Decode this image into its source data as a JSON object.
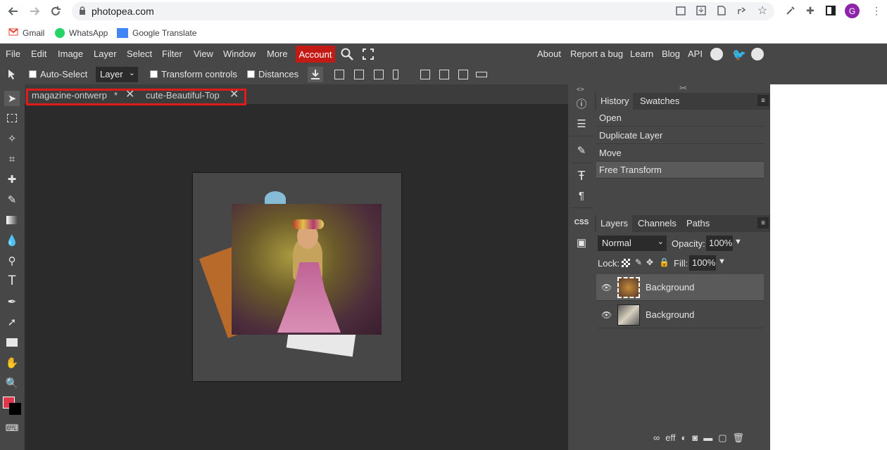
{
  "browser": {
    "url": "photopea.com",
    "avatar_letter": "G",
    "bookmarks": [
      {
        "label": "Gmail",
        "icon": "gmail-icon"
      },
      {
        "label": "WhatsApp",
        "icon": "whatsapp-icon"
      },
      {
        "label": "Google Translate",
        "icon": "translate-icon"
      }
    ]
  },
  "menubar": {
    "items": [
      "File",
      "Edit",
      "Image",
      "Layer",
      "Select",
      "Filter",
      "View",
      "Window",
      "More"
    ],
    "account_label": "Account",
    "right_links": [
      "About",
      "Report a bug",
      "Learn",
      "Blog",
      "API"
    ]
  },
  "options": {
    "auto_select": "Auto-Select",
    "layer_select": "Layer",
    "transform_controls": "Transform controls",
    "distances": "Distances"
  },
  "tabs": [
    {
      "label": "magazine-ontwerp",
      "modified": "*"
    },
    {
      "label": "cute-Beautiful-Top"
    }
  ],
  "history_panel": {
    "tabs": [
      "History",
      "Swatches"
    ],
    "rows": [
      "Open",
      "Duplicate Layer",
      "Move",
      "Free Transform"
    ],
    "selected": "Free Transform"
  },
  "layers_panel": {
    "tabs": [
      "Layers",
      "Channels",
      "Paths"
    ],
    "blend_mode": "Normal",
    "opacity_label": "Opacity:",
    "opacity_value": "100%",
    "lock_label": "Lock:",
    "fill_label": "Fill:",
    "fill_value": "100%",
    "layers": [
      {
        "name": "Background",
        "selected": true
      },
      {
        "name": "Background",
        "selected": false
      }
    ]
  },
  "colors": {
    "accent_red": "#c41a16",
    "highlight_border": "#e01b1b",
    "foreground_color": "#e0364b",
    "background_color": "#000000"
  },
  "minibar": {
    "css_label": "CSS"
  }
}
